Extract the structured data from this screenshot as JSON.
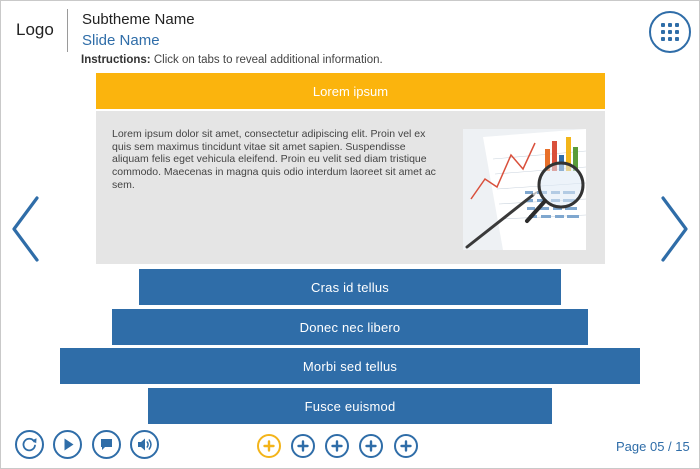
{
  "header": {
    "logo": "Logo",
    "subtheme": "Subtheme Name",
    "slide_name": "Slide Name",
    "instructions_label": "Instructions:",
    "instructions_text": "Click on tabs to reveal additional information."
  },
  "colors": {
    "primary": "#2f6da8",
    "active_tab": "#fbb40d",
    "content_bg": "#e5e5e5"
  },
  "tabs": {
    "open": {
      "title": "Lorem ipsum",
      "body": "Lorem ipsum dolor sit amet, consectetur adipiscing elit. Proin vel ex quis sem maximus tincidunt vitae sit amet sapien. Suspendisse aliquam felis eget vehicula eleifend. Proin eu velit sed diam tristique commodo. Maecenas in magna quis odio interdum laoreet sit amet ac sem.",
      "image_icon": "financial-chart-with-magnifier-image"
    },
    "items": [
      {
        "label": "Cras id tellus"
      },
      {
        "label": "Donec nec libero"
      },
      {
        "label": "Morbi sed tellus"
      },
      {
        "label": "Fusce euismod"
      }
    ]
  },
  "navigation": {
    "prev_icon": "chevron-left-icon",
    "next_icon": "chevron-right-icon",
    "menu_icon": "grid-menu-icon"
  },
  "controls": {
    "buttons": [
      "replay-icon",
      "play-icon",
      "chat-icon",
      "audio-icon"
    ]
  },
  "progress": {
    "dots": 5,
    "active_index": 0,
    "dot_icon": "plus-icon"
  },
  "footer": {
    "page_label": "Page 05 / 15"
  }
}
